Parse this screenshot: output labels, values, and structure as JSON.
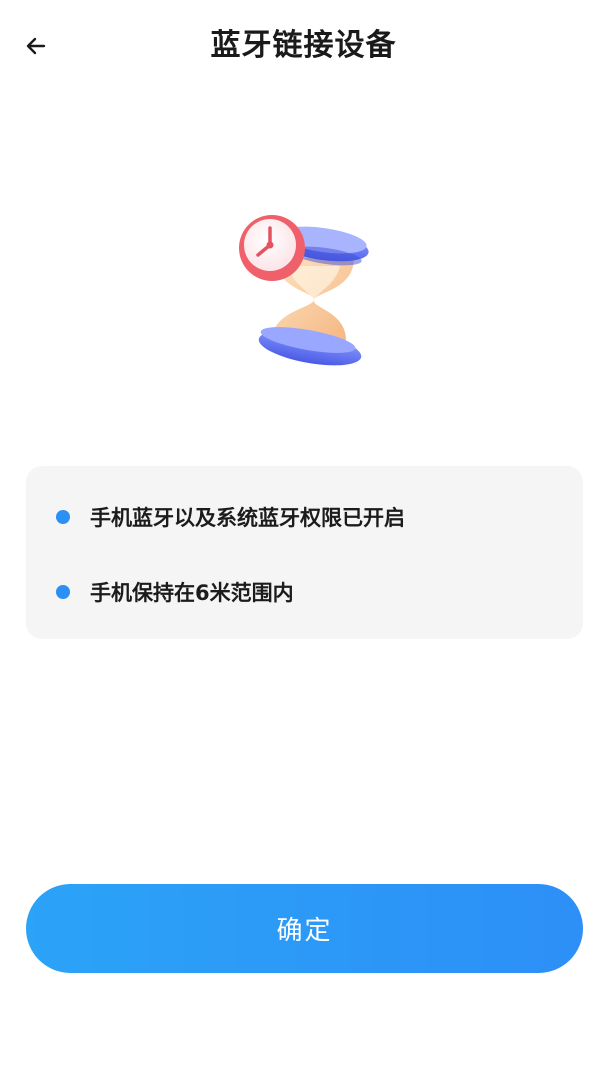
{
  "header": {
    "title": "蓝牙链接设备",
    "back_icon": "arrow-left-icon"
  },
  "illustration": {
    "icon": "hourglass-clock-icon"
  },
  "tips": {
    "items": [
      {
        "text": "手机蓝牙以及系统蓝牙权限已开启"
      },
      {
        "text": "手机保持在6米范围内"
      }
    ],
    "bullet_color": "#2b8ff3"
  },
  "footer": {
    "confirm_label": "确定",
    "button_color": "#2d8ff7"
  }
}
